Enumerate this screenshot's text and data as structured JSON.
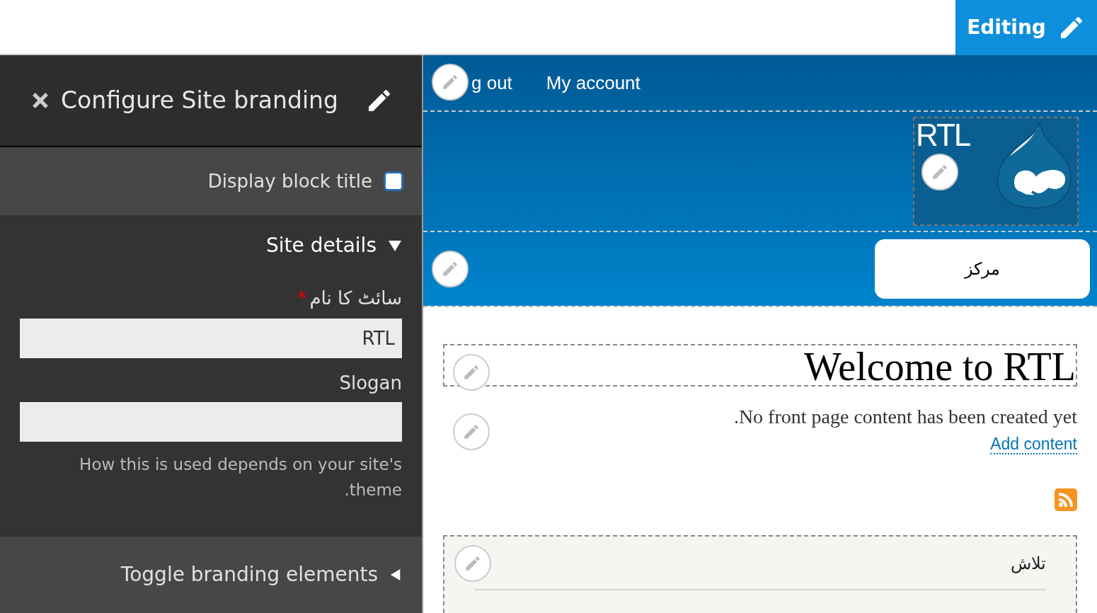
{
  "toolbar": {
    "editing_button": "Editing"
  },
  "sidebar": {
    "title": "Configure Site branding",
    "display_block_title": {
      "label": "Display block title",
      "checked": false
    },
    "site_details": {
      "label": "Site details",
      "expanded": true
    },
    "fields": [
      {
        "label": "سائٹ کا نام",
        "required_mark": "*",
        "value": "RTL"
      },
      {
        "label": "Slogan"
      }
    ],
    "description": [
      "How this is used depends on your site's",
      ".theme"
    ],
    "toggle_branding": {
      "label": "Toggle branding elements",
      "expanded": false
    }
  },
  "site": {
    "menu": [
      "g out",
      "My account"
    ],
    "site_name": "RTL",
    "nav_tab": "مرکز",
    "page_title": "Welcome to RTL",
    "message": ".No front page content has been created yet",
    "add_content_link": "Add content",
    "search_title": "تلاش"
  }
}
